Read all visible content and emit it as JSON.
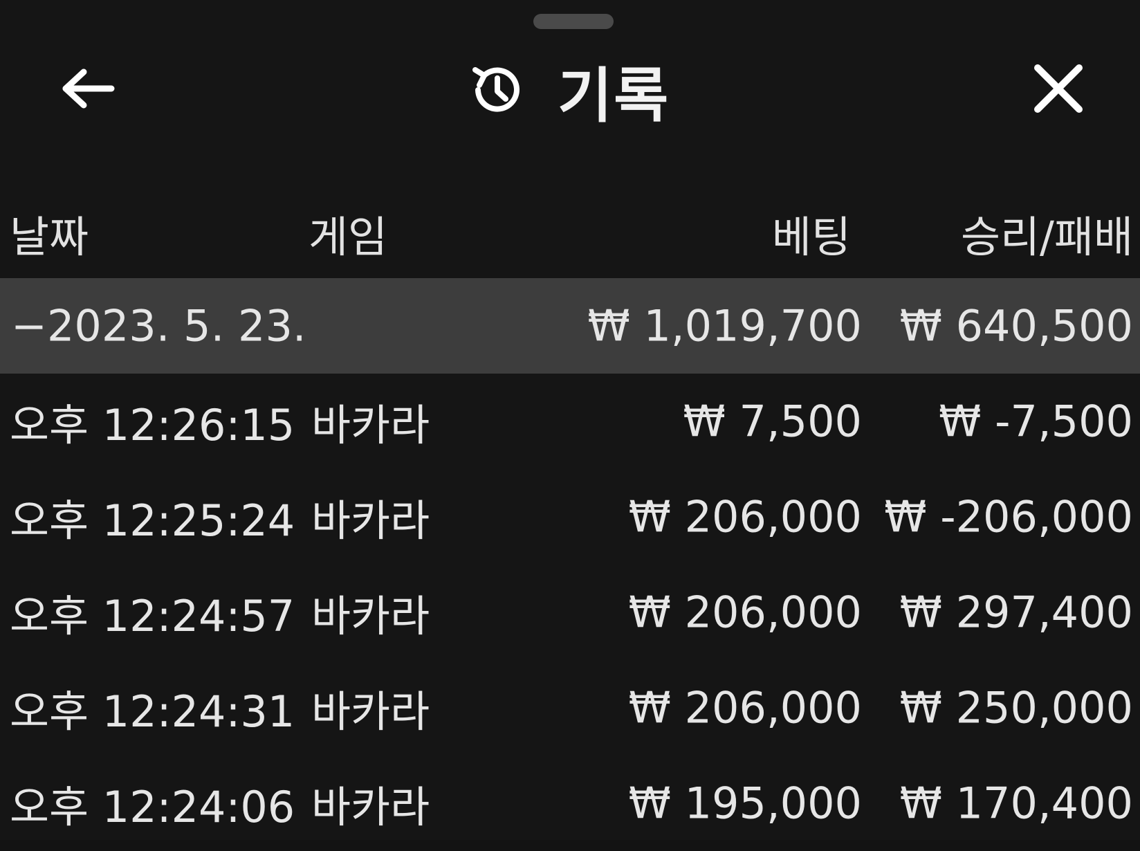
{
  "header": {
    "title": "기록",
    "back_icon": "arrow-left-icon",
    "history_icon": "history-icon",
    "close_icon": "close-icon"
  },
  "table": {
    "columns": {
      "date": "날짜",
      "game": "게임",
      "bet": "베팅",
      "result": "승리/패배"
    },
    "summary": {
      "date": "−2023. 5. 23.",
      "bet": "₩ 1,019,700",
      "result": "₩ 640,500"
    },
    "rows": [
      {
        "time": "오후 12:26:15",
        "game": "바카라",
        "bet": "₩ 7,500",
        "result": "₩ -7,500"
      },
      {
        "time": "오후 12:25:24",
        "game": "바카라",
        "bet": "₩ 206,000",
        "result": "₩ -206,000"
      },
      {
        "time": "오후 12:24:57",
        "game": "바카라",
        "bet": "₩ 206,000",
        "result": "₩ 297,400"
      },
      {
        "time": "오후 12:24:31",
        "game": "바카라",
        "bet": "₩ 206,000",
        "result": "₩ 250,000"
      },
      {
        "time": "오후 12:24:06",
        "game": "바카라",
        "bet": "₩ 195,000",
        "result": "₩ 170,400"
      }
    ]
  },
  "colors": {
    "background": "#151515",
    "summary_row": "#3d3d3d",
    "text": "#e6e6e6"
  }
}
